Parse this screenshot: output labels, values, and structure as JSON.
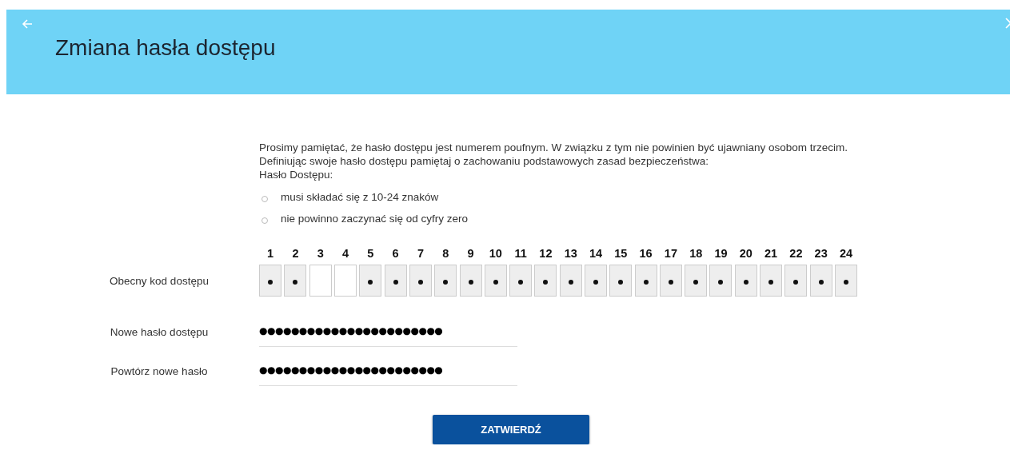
{
  "header": {
    "title": "Zmiana hasła dostępu"
  },
  "intro": [
    "Prosimy pamiętać, że hasło dostępu jest numerem poufnym. W związku z tym nie powinien być ujawniany osobom trzecim.",
    "Definiując swoje hasło dostępu pamiętaj o zachowaniu podstawowych zasad bezpieczeństwa:",
    "Hasło Dostępu:"
  ],
  "rules": [
    "musi składać się z 10-24 znaków",
    "nie powinno zaczynać się od cyfry zero"
  ],
  "current_code": {
    "label": "Obecny kod dostępu",
    "positions": [
      {
        "number": "1",
        "disabled": true
      },
      {
        "number": "2",
        "disabled": true
      },
      {
        "number": "3",
        "disabled": false
      },
      {
        "number": "4",
        "disabled": false
      },
      {
        "number": "5",
        "disabled": true
      },
      {
        "number": "6",
        "disabled": true
      },
      {
        "number": "7",
        "disabled": true
      },
      {
        "number": "8",
        "disabled": true
      },
      {
        "number": "9",
        "disabled": true
      },
      {
        "number": "10",
        "disabled": true
      },
      {
        "number": "11",
        "disabled": true
      },
      {
        "number": "12",
        "disabled": true
      },
      {
        "number": "13",
        "disabled": true
      },
      {
        "number": "14",
        "disabled": true
      },
      {
        "number": "15",
        "disabled": true
      },
      {
        "number": "16",
        "disabled": true
      },
      {
        "number": "17",
        "disabled": true
      },
      {
        "number": "18",
        "disabled": true
      },
      {
        "number": "19",
        "disabled": true
      },
      {
        "number": "20",
        "disabled": true
      },
      {
        "number": "21",
        "disabled": true
      },
      {
        "number": "22",
        "disabled": true
      },
      {
        "number": "23",
        "disabled": true
      },
      {
        "number": "24",
        "disabled": true
      }
    ]
  },
  "fields": [
    {
      "label": "Nowe hasło dostępu",
      "value": "●●●●●●●●●●●●●●●●●●●●●●●"
    },
    {
      "label": "Powtórz nowe hasło",
      "value": "●●●●●●●●●●●●●●●●●●●●●●●"
    }
  ],
  "submit": {
    "label": "ZATWIERDŹ"
  }
}
